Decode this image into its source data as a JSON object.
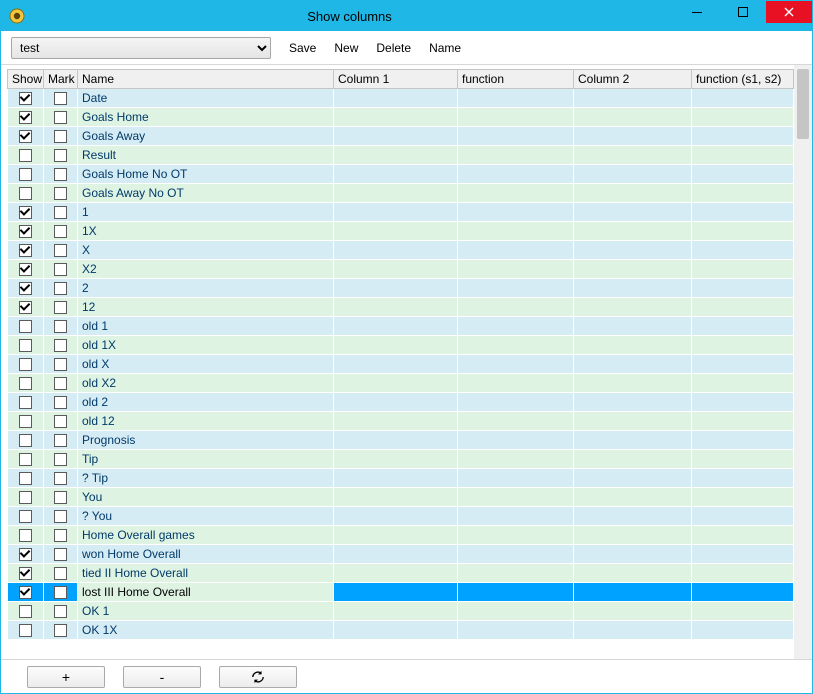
{
  "window": {
    "title": "Show columns"
  },
  "toolbar": {
    "preset": "test",
    "save": "Save",
    "new": "New",
    "delete": "Delete",
    "name": "Name"
  },
  "headers": {
    "show": "Show",
    "mark": "Mark",
    "name": "Name",
    "col1": "Column 1",
    "fn": "function",
    "col2": "Column 2",
    "fn2": "function (s1, s2)"
  },
  "rows": [
    {
      "name": "Date",
      "show": true,
      "mark": false,
      "col1": "",
      "fn": "",
      "col2": "",
      "fn2": "",
      "tint": "blue",
      "selected": false
    },
    {
      "name": "Goals Home",
      "show": true,
      "mark": false,
      "col1": "",
      "fn": "",
      "col2": "",
      "fn2": "",
      "tint": "green",
      "selected": false
    },
    {
      "name": "Goals Away",
      "show": true,
      "mark": false,
      "col1": "",
      "fn": "",
      "col2": "",
      "fn2": "",
      "tint": "blue",
      "selected": false
    },
    {
      "name": "Result",
      "show": false,
      "mark": false,
      "col1": "",
      "fn": "",
      "col2": "",
      "fn2": "",
      "tint": "green",
      "selected": false
    },
    {
      "name": "Goals Home No OT",
      "show": false,
      "mark": false,
      "col1": "",
      "fn": "",
      "col2": "",
      "fn2": "",
      "tint": "blue",
      "selected": false
    },
    {
      "name": "Goals Away No OT",
      "show": false,
      "mark": false,
      "col1": "",
      "fn": "",
      "col2": "",
      "fn2": "",
      "tint": "green",
      "selected": false
    },
    {
      "name": "1",
      "show": true,
      "mark": false,
      "col1": "",
      "fn": "",
      "col2": "",
      "fn2": "",
      "tint": "blue",
      "selected": false
    },
    {
      "name": "1X",
      "show": true,
      "mark": false,
      "col1": "",
      "fn": "",
      "col2": "",
      "fn2": "",
      "tint": "green",
      "selected": false
    },
    {
      "name": "X",
      "show": true,
      "mark": false,
      "col1": "",
      "fn": "",
      "col2": "",
      "fn2": "",
      "tint": "blue",
      "selected": false
    },
    {
      "name": "X2",
      "show": true,
      "mark": false,
      "col1": "",
      "fn": "",
      "col2": "",
      "fn2": "",
      "tint": "green",
      "selected": false
    },
    {
      "name": "2",
      "show": true,
      "mark": false,
      "col1": "",
      "fn": "",
      "col2": "",
      "fn2": "",
      "tint": "blue",
      "selected": false
    },
    {
      "name": "12",
      "show": true,
      "mark": false,
      "col1": "",
      "fn": "",
      "col2": "",
      "fn2": "",
      "tint": "green",
      "selected": false
    },
    {
      "name": "old 1",
      "show": false,
      "mark": false,
      "col1": "",
      "fn": "",
      "col2": "",
      "fn2": "",
      "tint": "blue",
      "selected": false
    },
    {
      "name": "old 1X",
      "show": false,
      "mark": false,
      "col1": "",
      "fn": "",
      "col2": "",
      "fn2": "",
      "tint": "green",
      "selected": false
    },
    {
      "name": "old X",
      "show": false,
      "mark": false,
      "col1": "",
      "fn": "",
      "col2": "",
      "fn2": "",
      "tint": "blue",
      "selected": false
    },
    {
      "name": "old X2",
      "show": false,
      "mark": false,
      "col1": "",
      "fn": "",
      "col2": "",
      "fn2": "",
      "tint": "green",
      "selected": false
    },
    {
      "name": "old 2",
      "show": false,
      "mark": false,
      "col1": "",
      "fn": "",
      "col2": "",
      "fn2": "",
      "tint": "blue",
      "selected": false
    },
    {
      "name": "old 12",
      "show": false,
      "mark": false,
      "col1": "",
      "fn": "",
      "col2": "",
      "fn2": "",
      "tint": "green",
      "selected": false
    },
    {
      "name": "Prognosis",
      "show": false,
      "mark": false,
      "col1": "",
      "fn": "",
      "col2": "",
      "fn2": "",
      "tint": "blue",
      "selected": false
    },
    {
      "name": "Tip",
      "show": false,
      "mark": false,
      "col1": "",
      "fn": "",
      "col2": "",
      "fn2": "",
      "tint": "green",
      "selected": false
    },
    {
      "name": "? Tip",
      "show": false,
      "mark": false,
      "col1": "",
      "fn": "",
      "col2": "",
      "fn2": "",
      "tint": "blue",
      "selected": false
    },
    {
      "name": "You",
      "show": false,
      "mark": false,
      "col1": "",
      "fn": "",
      "col2": "",
      "fn2": "",
      "tint": "green",
      "selected": false
    },
    {
      "name": "? You",
      "show": false,
      "mark": false,
      "col1": "",
      "fn": "",
      "col2": "",
      "fn2": "",
      "tint": "blue",
      "selected": false
    },
    {
      "name": "Home Overall games",
      "show": false,
      "mark": false,
      "col1": "",
      "fn": "",
      "col2": "",
      "fn2": "",
      "tint": "green",
      "selected": false
    },
    {
      "name": "won Home Overall",
      "show": true,
      "mark": false,
      "col1": "",
      "fn": "",
      "col2": "",
      "fn2": "",
      "tint": "blue",
      "selected": false
    },
    {
      "name": "tied II Home Overall",
      "show": true,
      "mark": false,
      "col1": "",
      "fn": "",
      "col2": "",
      "fn2": "",
      "tint": "green",
      "selected": false
    },
    {
      "name": "lost III Home Overall",
      "show": true,
      "mark": false,
      "col1": "",
      "fn": "",
      "col2": "",
      "fn2": "",
      "tint": "selected",
      "selected": true
    },
    {
      "name": "OK 1",
      "show": false,
      "mark": false,
      "col1": "",
      "fn": "",
      "col2": "",
      "fn2": "",
      "tint": "green",
      "selected": false
    },
    {
      "name": "OK 1X",
      "show": false,
      "mark": false,
      "col1": "",
      "fn": "",
      "col2": "",
      "fn2": "",
      "tint": "blue",
      "selected": false
    }
  ],
  "footer": {
    "plus": "+",
    "minus": "-"
  }
}
